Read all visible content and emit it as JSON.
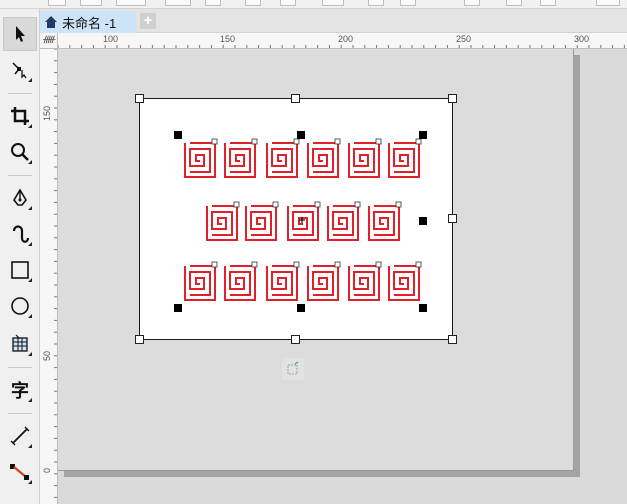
{
  "document": {
    "tab_title": "未命名 -1",
    "add_tab_label": "+"
  },
  "rulers": {
    "horizontal": [
      "100",
      "150",
      "200",
      "250",
      "300"
    ],
    "vertical": [
      "150",
      "50",
      "0"
    ],
    "corner_label": "ᚏ"
  },
  "toolbox": {
    "items": [
      {
        "name": "pick-tool",
        "icon": "arrow-pointer-icon"
      },
      {
        "name": "shape-tool",
        "icon": "node-edit-icon"
      },
      {
        "name": "crop-tool",
        "icon": "crop-icon"
      },
      {
        "name": "zoom-tool",
        "icon": "magnifier-icon"
      },
      {
        "name": "pen-tool",
        "icon": "pen-nib-icon"
      },
      {
        "name": "artistic-media-tool",
        "icon": "curve-icon"
      },
      {
        "name": "rectangle-tool",
        "icon": "rectangle-icon"
      },
      {
        "name": "ellipse-tool",
        "icon": "ellipse-icon"
      },
      {
        "name": "table-tool",
        "icon": "table-icon"
      },
      {
        "name": "text-tool",
        "icon": "text-icon",
        "glyph": "字"
      },
      {
        "name": "dimension-tool",
        "icon": "dimension-icon"
      },
      {
        "name": "connector-tool",
        "icon": "connector-icon"
      }
    ]
  },
  "artwork": {
    "stroke_color": "#e0202a",
    "rows": [
      6,
      5,
      6
    ]
  },
  "colors": {
    "accent_tab": "#cde3f7",
    "spiral": "#e0202a"
  }
}
